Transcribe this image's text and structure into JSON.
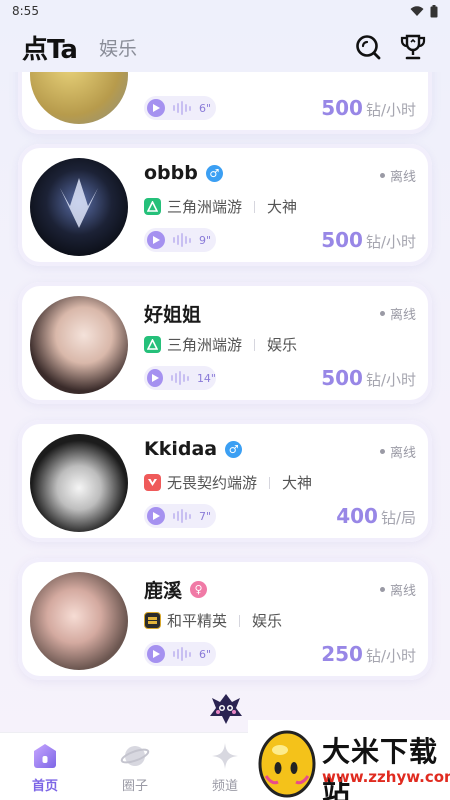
{
  "status_bar": {
    "time": "8:55"
  },
  "header": {
    "brand": "点Ta",
    "tab_entertainment": "娱乐"
  },
  "colors": {
    "accent": "#9887e6",
    "tab_active": "#7d66e6",
    "male": "#3b9ff3",
    "female": "#f07aa6"
  },
  "cards": [
    {
      "name": "",
      "status": "",
      "game": "",
      "category": "",
      "voice_duration": "6\"",
      "price": "500",
      "unit": "钻/小时"
    },
    {
      "name": "obbb",
      "gender": "male",
      "status": "离线",
      "game": "三角洲端游",
      "game_icon": "delta-game-icon",
      "category": "大神",
      "voice_duration": "9\"",
      "price": "500",
      "unit": "钻/小时"
    },
    {
      "name": "好姐姐",
      "gender": "none",
      "status": "离线",
      "game": "三角洲端游",
      "game_icon": "delta-game-icon",
      "category": "娱乐",
      "voice_duration": "14\"",
      "price": "500",
      "unit": "钻/小时"
    },
    {
      "name": "Kkidaa",
      "gender": "male",
      "status": "离线",
      "game": "无畏契约端游",
      "game_icon": "valorant-game-icon",
      "category": "大神",
      "voice_duration": "7\"",
      "price": "400",
      "unit": "钻/局"
    },
    {
      "name": "鹿溪",
      "gender": "female",
      "status": "离线",
      "game": "和平精英",
      "game_icon": "peace-elite-game-icon",
      "category": "娱乐",
      "voice_duration": "6\"",
      "price": "250",
      "unit": "钻/小时"
    }
  ],
  "tabbar": [
    {
      "label": "首页",
      "icon": "home-icon",
      "active": true
    },
    {
      "label": "圈子",
      "icon": "planet-icon",
      "active": false
    },
    {
      "label": "频道",
      "icon": "sparkle-icon",
      "active": false
    }
  ],
  "watermark": {
    "title": "大米下载站",
    "url": "www.zzhyw.com"
  }
}
